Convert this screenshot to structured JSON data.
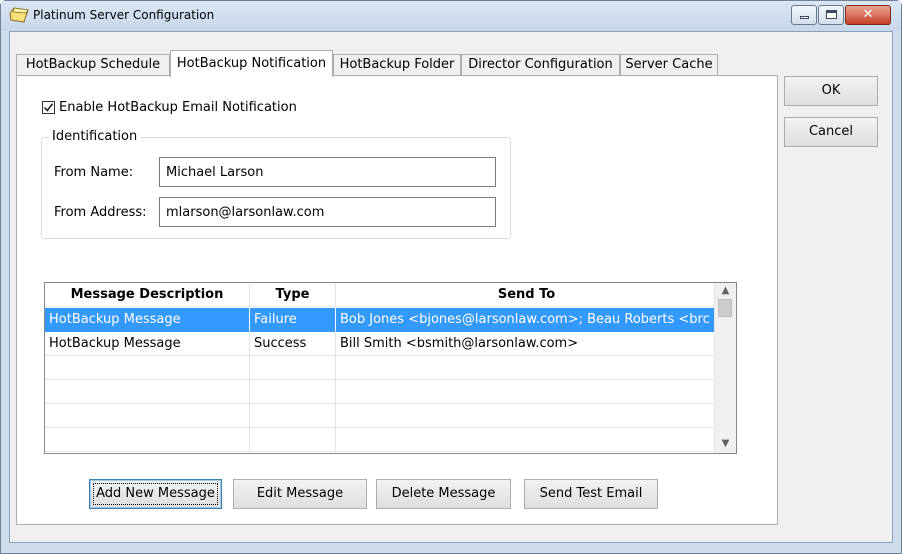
{
  "window": {
    "title": "Platinum Server Configuration",
    "close_glyph": "✕"
  },
  "tabs": [
    {
      "label": "HotBackup Schedule",
      "active": false
    },
    {
      "label": "HotBackup Notification",
      "active": true
    },
    {
      "label": "HotBackup Folder",
      "active": false
    },
    {
      "label": "Director Configuration",
      "active": false
    },
    {
      "label": "Server Cache",
      "active": false
    }
  ],
  "notification": {
    "enable_label": "Enable HotBackup Email Notification",
    "enable_checked": true,
    "identification_title": "Identification",
    "from_name_label": "From Name:",
    "from_name_value": "Michael Larson",
    "from_address_label": "From Address:",
    "from_address_value": "mlarson@larsonlaw.com"
  },
  "messages": {
    "columns": [
      "Message Description",
      "Type",
      "Send To"
    ],
    "rows": [
      {
        "description": "HotBackup Message",
        "type": "Failure",
        "send_to": "Bob Jones <bjones@larsonlaw.com>; Beau Roberts <brc",
        "selected": true
      },
      {
        "description": "HotBackup Message",
        "type": "Success",
        "send_to": "Bill Smith <bsmith@larsonlaw.com>",
        "selected": false
      },
      {
        "description": "",
        "type": "",
        "send_to": "",
        "selected": false
      },
      {
        "description": "",
        "type": "",
        "send_to": "",
        "selected": false
      },
      {
        "description": "",
        "type": "",
        "send_to": "",
        "selected": false
      },
      {
        "description": "",
        "type": "",
        "send_to": "",
        "selected": false
      }
    ],
    "scroll_up_glyph": "▲",
    "scroll_down_glyph": "▼"
  },
  "buttons": {
    "ok": "OK",
    "cancel": "Cancel",
    "add_new_message": "Add New Message",
    "edit_message": "Edit Message",
    "delete_message": "Delete Message",
    "send_test_email": "Send Test Email"
  },
  "colors": {
    "selection": "#3399ff",
    "titlebar": "#c7d6ea",
    "close_button": "#c8412a"
  }
}
